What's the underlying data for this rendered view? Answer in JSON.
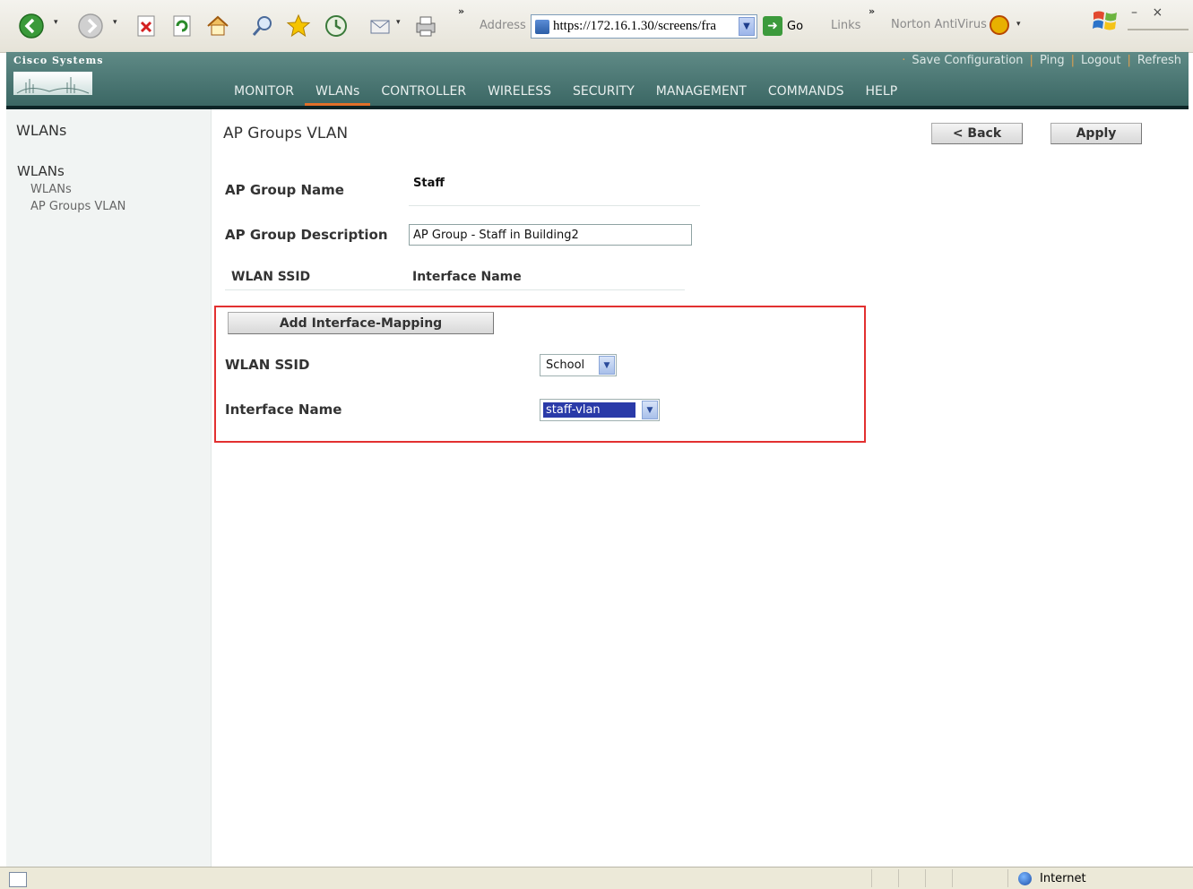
{
  "browser": {
    "address_label": "Address",
    "url": "https://172.16.1.30/screens/fra",
    "go_label": "Go",
    "links_label": "Links",
    "chevron": "»",
    "norton_label": "Norton AntiVirus",
    "window_controls": "–  ×",
    "status_zone": "Internet"
  },
  "cisco": {
    "logo_text": "Cisco Systems",
    "top_links": [
      "Save Configuration",
      "Ping",
      "Logout",
      "Refresh"
    ],
    "nav": [
      "MONITOR",
      "WLANs",
      "CONTROLLER",
      "WIRELESS",
      "SECURITY",
      "MANAGEMENT",
      "COMMANDS",
      "HELP"
    ],
    "active_nav": "WLANs"
  },
  "sidebar": {
    "title": "WLANs",
    "group": "WLANs",
    "items": [
      "WLANs",
      "AP Groups VLAN"
    ]
  },
  "page": {
    "title": "AP Groups VLAN",
    "back_label": "< Back",
    "apply_label": "Apply",
    "ap_group_name_label": "AP Group Name",
    "ap_group_name_value": "Staff",
    "ap_group_desc_label": "AP Group Description",
    "ap_group_desc_value": "AP Group - Staff in Building2",
    "col_wlan_ssid": "WLAN SSID",
    "col_interface_name": "Interface Name",
    "add_mapping_label": "Add Interface-Mapping",
    "wlan_ssid_label": "WLAN SSID",
    "wlan_ssid_selected": "School",
    "interface_name_label": "Interface Name",
    "interface_name_selected": "staff-vlan"
  },
  "colors": {
    "header_teal": "#4b7874",
    "active_tab": "#e0702a",
    "highlight_red": "#e23030"
  }
}
